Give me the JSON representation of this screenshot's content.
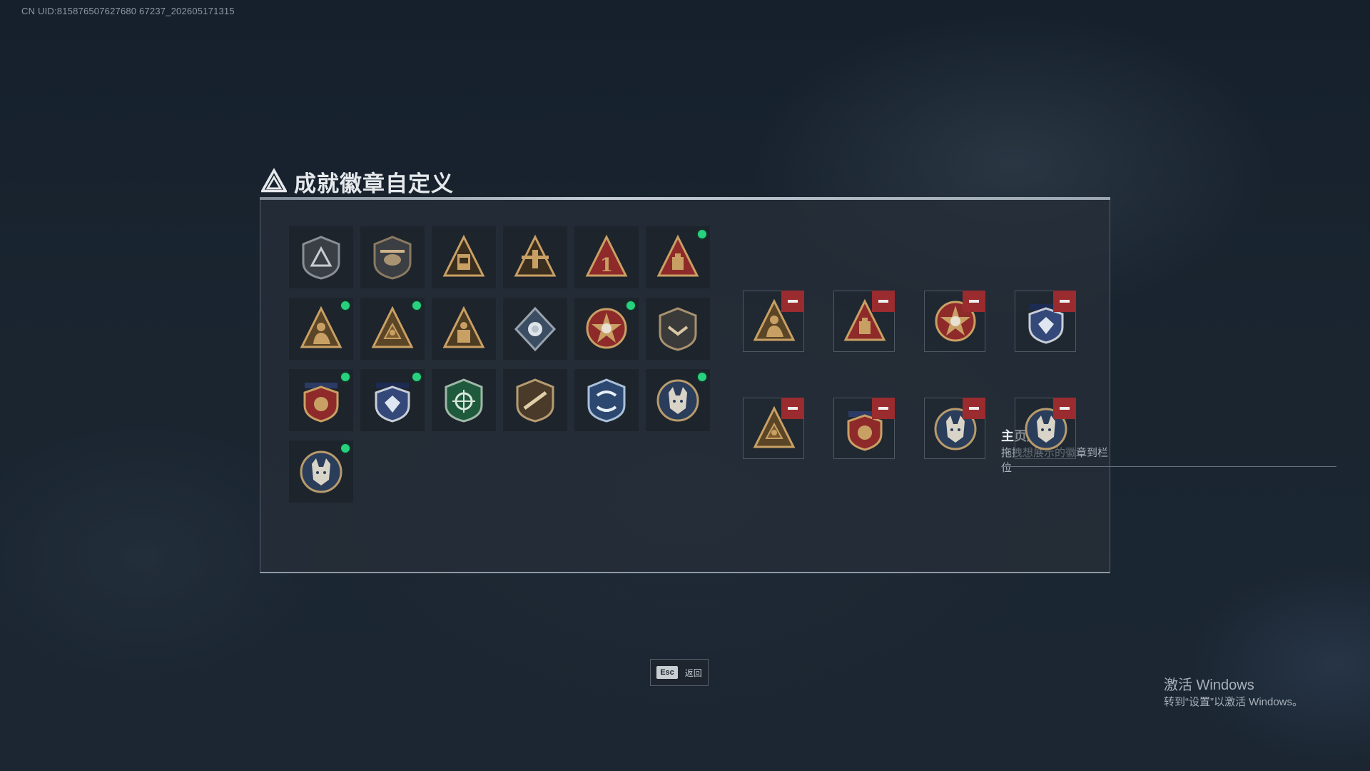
{
  "uid_text": "CN UID:815876507627680 67237_202605171315",
  "title": "成就徽章自定义",
  "badges": [
    {
      "icon": "shield-triangle-icon",
      "new": false
    },
    {
      "icon": "helicopter-shield-icon",
      "new": false
    },
    {
      "icon": "gold-triangle-backpack-icon",
      "new": false
    },
    {
      "icon": "gold-triangle-aircraft-icon",
      "new": false
    },
    {
      "icon": "red-triangle-number-1-icon",
      "new": false
    },
    {
      "icon": "red-triangle-bag-icon",
      "new": true
    },
    {
      "icon": "gold-triangle-soldier-icon",
      "new": true
    },
    {
      "icon": "gold-triangle-emblem-icon",
      "new": true
    },
    {
      "icon": "gold-triangle-figure-icon",
      "new": false
    },
    {
      "icon": "silver-diamond-rose-icon",
      "new": false
    },
    {
      "icon": "star-skull-medal-icon",
      "new": true
    },
    {
      "icon": "dark-shield-chevron-icon",
      "new": false
    },
    {
      "icon": "red-gold-ribbon-shield-icon",
      "new": true
    },
    {
      "icon": "blue-star-shield-gem-icon",
      "new": true
    },
    {
      "icon": "green-crosshair-shield-icon",
      "new": false
    },
    {
      "icon": "brown-rifle-shield-icon",
      "new": false
    },
    {
      "icon": "blue-arrows-shield-icon",
      "new": false
    },
    {
      "icon": "wolf-round-emblem-icon",
      "new": true
    },
    {
      "icon": "wolf-round-emblem-icon",
      "new": true
    }
  ],
  "showcase": {
    "title": "主页展示",
    "subtitle": "拖拽想展示的徽章到栏位",
    "slots": [
      {
        "icon": "gold-triangle-soldier-icon"
      },
      {
        "icon": "red-triangle-bag-icon"
      },
      {
        "icon": "star-skull-medal-icon"
      },
      {
        "icon": "blue-star-shield-gem-icon"
      },
      {
        "icon": "gold-triangle-emblem-icon"
      },
      {
        "icon": "red-gold-ribbon-shield-icon"
      },
      {
        "icon": "wolf-round-emblem-icon"
      },
      {
        "icon": "wolf-round-emblem-icon"
      }
    ]
  },
  "esc": {
    "key": "Esc",
    "label": "返回"
  },
  "windows_notice": {
    "line1": "激活 Windows",
    "line2": "转到“设置”以激活 Windows。"
  },
  "colors": {
    "gold": "#c9a064",
    "red": "#9a2b2e",
    "green_dot": "#27d17d",
    "navy": "#2b3b66"
  }
}
